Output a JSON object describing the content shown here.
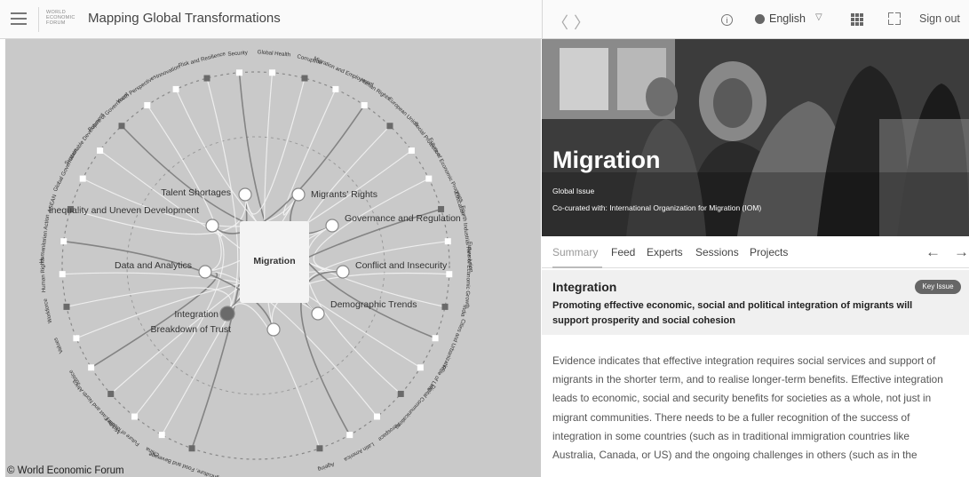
{
  "header": {
    "logo_text": "WORLD ECONOMIC FORUM",
    "title": "Mapping Global Transformations",
    "language": "English",
    "sign_out": "Sign out",
    "nav_back": "〈",
    "nav_forward": "〉"
  },
  "map": {
    "center_label": "Migration",
    "copyright": "© World Economic Forum",
    "key_issues": [
      "Talent Shortages",
      "Migrants' Rights",
      "Inequality and Uneven Development",
      "Governance and Regulation",
      "Data and Analytics",
      "Conflict and Insecurity",
      "Integration",
      "Demographic Trends",
      "Breakdown of Trust"
    ],
    "outer_topics": [
      "Agriculture, Food and Beverage",
      "China",
      "Future of Mobility",
      "Middle East and North Africa",
      "Justice",
      "Values",
      "Workforce",
      "Human Rights",
      "Humanitarian Action",
      "ASEAN",
      "Global Governance",
      "Sustainable Development",
      "Future of Government",
      "Youth Perspectives",
      "Innovation",
      "Risk and Resilience",
      "Security",
      "Global Health",
      "Corruption",
      "Migration and Employment",
      "Human Rights",
      "European Union",
      "Social Protection",
      "Future of Economic Progress",
      "Education",
      "Fourth Industrial Revolution",
      "Future of Economic Growth",
      "India",
      "Cities and Urbanization",
      "Rule of Law",
      "Digital Communications",
      "Aerospace",
      "Latin America",
      "Ageing"
    ]
  },
  "detail": {
    "title": "Migration",
    "subtitle": "Global Issue",
    "curated": "Co-curated with: International Organization for Migration (IOM)",
    "tabs": [
      "Summary",
      "Feed",
      "Experts",
      "Sessions",
      "Projects"
    ],
    "section_title": "Integration",
    "badge": "Key Issue",
    "section_desc": "Promoting effective economic, social and political integration of migrants will support prosperity and social cohesion",
    "body": "Evidence indicates that effective integration requires social services and support of migrants in the shorter term, and to realise longer-term benefits. Effective integration leads to economic, social and security benefits for societies as a whole, not just in migrant communities.  There needs to be a fuller recognition of the success of integration in some countries (such as in traditional immigration countries like Australia, Canada, or US) and the ongoing challenges in others (such as in the"
  }
}
